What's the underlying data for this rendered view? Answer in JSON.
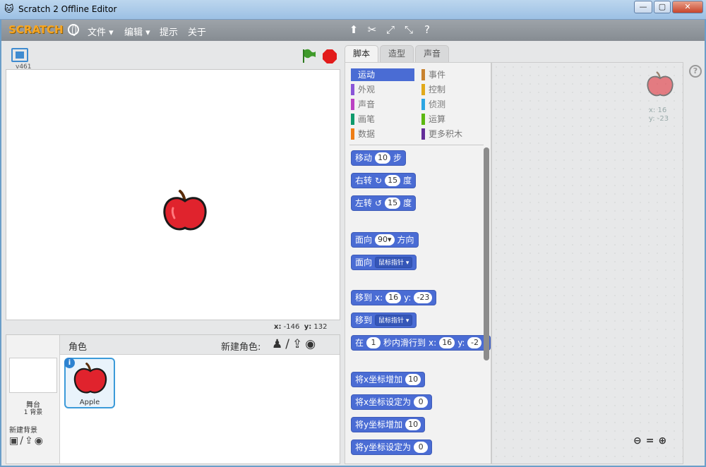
{
  "window": {
    "title": "Scratch 2 Offline Editor",
    "minimize_label": "—",
    "maximize_label": "▢",
    "close_label": "✕"
  },
  "menubar": {
    "logo": "SCRATCH",
    "items": [
      "文件 ▾",
      "编辑 ▾",
      "提示",
      "关于"
    ],
    "tools": [
      "duplicate-icon",
      "delete-icon",
      "grow-icon",
      "shrink-icon",
      "help-icon"
    ]
  },
  "stage": {
    "version": "v461",
    "coords": {
      "x_label": "x:",
      "x": "-146",
      "y_label": "y:",
      "y": "132"
    }
  },
  "sprites": {
    "title": "角色",
    "new_sprite_label": "新建角色:",
    "stage_label": "舞台",
    "backdrop_count": "1 背景",
    "new_backdrop_label": "新建背景",
    "sprite_list": [
      {
        "name": "Apple",
        "info": "i"
      }
    ]
  },
  "tabs": [
    "脚本",
    "造型",
    "声音"
  ],
  "categories": [
    {
      "label": "运动",
      "color": "#4a6cd4"
    },
    {
      "label": "事件",
      "color": "#c88330"
    },
    {
      "label": "外观",
      "color": "#8a55d7"
    },
    {
      "label": "控制",
      "color": "#e1a91a"
    },
    {
      "label": "声音",
      "color": "#bb42c3"
    },
    {
      "label": "侦测",
      "color": "#2ca5e2"
    },
    {
      "label": "画笔",
      "color": "#0e9a6c"
    },
    {
      "label": "运算",
      "color": "#5cb712"
    },
    {
      "label": "数据",
      "color": "#ee7d16"
    },
    {
      "label": "更多积木",
      "color": "#632d99"
    }
  ],
  "blocks": {
    "move": {
      "label": "移动",
      "value": "10",
      "suffix": "步"
    },
    "turn_right": {
      "label": "右转",
      "icon": "↻",
      "value": "15",
      "suffix": "度"
    },
    "turn_left": {
      "label": "左转",
      "icon": "↺",
      "value": "15",
      "suffix": "度"
    },
    "point_dir": {
      "label": "面向",
      "value": "90▾",
      "suffix": "方向"
    },
    "point_towards": {
      "label": "面向",
      "dropdown": "鼠标指针 ▾"
    },
    "goto_xy": {
      "label": "移到",
      "x_label": "x:",
      "x": "16",
      "y_label": "y:",
      "y": "-23"
    },
    "goto_target": {
      "label": "移到",
      "dropdown": "鼠标指针 ▾"
    },
    "glide": {
      "label": "在",
      "secs": "1",
      "mid": "秒内滑行到",
      "x_label": "x:",
      "x": "16",
      "y_label": "y:",
      "y": "-2"
    },
    "change_x": {
      "label": "将x坐标增加",
      "value": "10"
    },
    "set_x": {
      "label": "将x坐标设定为",
      "value": "0"
    },
    "change_y": {
      "label": "将y坐标增加",
      "value": "10"
    },
    "set_y": {
      "label": "将y坐标设定为",
      "value": "0"
    }
  },
  "script_area": {
    "sprite_x": "x: 16",
    "sprite_y": "y: -23"
  }
}
